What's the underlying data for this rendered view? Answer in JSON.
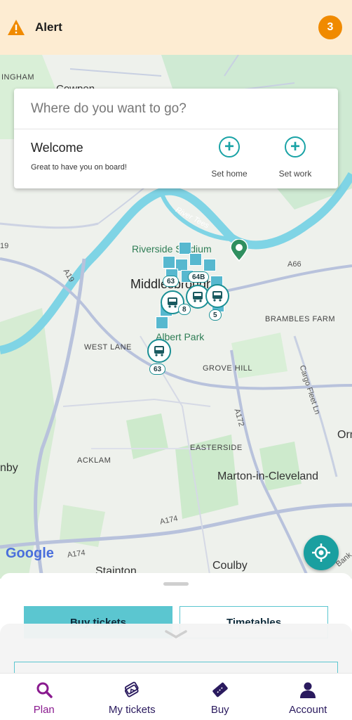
{
  "alert": {
    "label": "Alert",
    "count": "3",
    "icon": "warning-triangle-icon",
    "color": "#f08a00"
  },
  "search": {
    "placeholder": "Where do you want to go?"
  },
  "welcome": {
    "title": "Welcome",
    "subtitle": "Great to have you on board!",
    "set_home": "Set home",
    "set_work": "Set work"
  },
  "map": {
    "labels": {
      "ingham": "INGHAM",
      "cowpen": "Cowpen",
      "river_tees": "River Tees",
      "riverside": "Riverside Stadium",
      "middlesbrough": "Middlesbrough",
      "brambles": "BRAMBLES FARM",
      "west_lane": "WEST LANE",
      "albert_park": "Albert Park",
      "grove_hill": "GROVE HILL",
      "cargo_fleet": "Cargo Fleet Ln",
      "easterside": "EASTERSIDE",
      "acklam": "ACKLAM",
      "marton": "Marton-in-Cleveland",
      "nby": "nby",
      "orm": "Orm",
      "coulby": "Coulby",
      "stainton": "Stainton",
      "a19": "A19",
      "a19b": "19",
      "a66": "A66",
      "a174": "A174",
      "a174b": "A174",
      "a172": "A172",
      "bank": "Bank"
    },
    "route_tags": {
      "r63a": "63",
      "r64b": "64B",
      "r8": "8",
      "r5": "5",
      "r63b": "63"
    },
    "google": "Google"
  },
  "sheet": {
    "buy_tickets": "Buy tickets",
    "timetables": "Timetables"
  },
  "nav": {
    "items": [
      {
        "label": "Plan",
        "icon": "search-icon"
      },
      {
        "label": "My tickets",
        "icon": "tickets-icon"
      },
      {
        "label": "Buy",
        "icon": "ticket-icon"
      },
      {
        "label": "Account",
        "icon": "person-icon"
      }
    ],
    "active_color": "#8a1a8f",
    "color": "#2a1a5e"
  },
  "accent_color": "#1aa3a6"
}
